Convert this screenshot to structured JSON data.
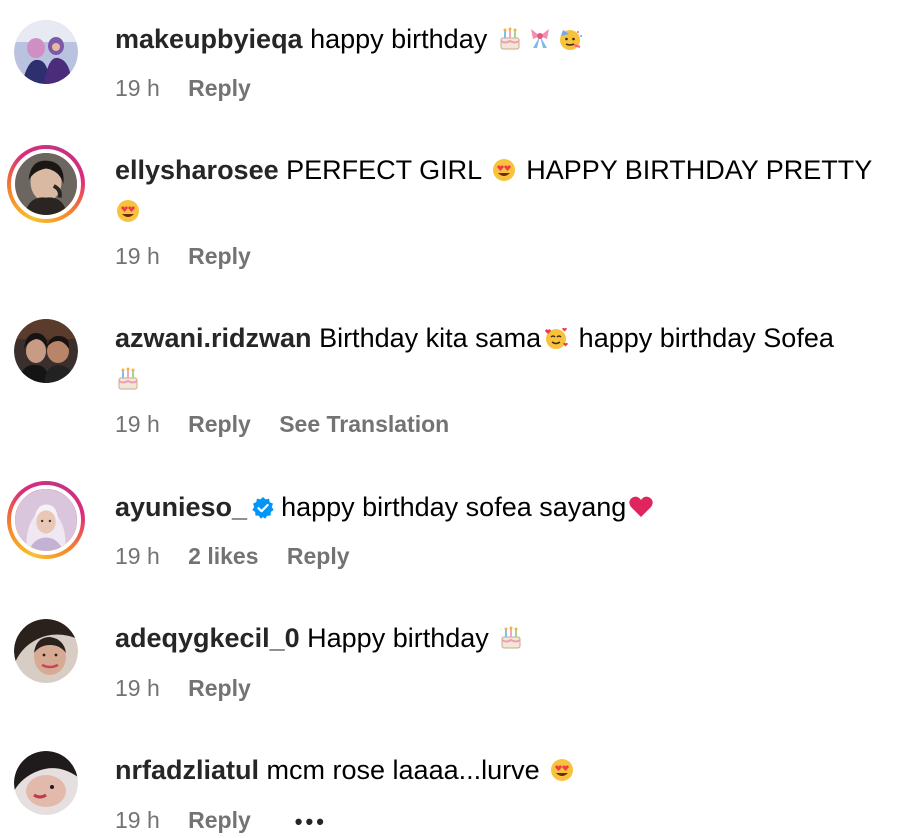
{
  "comments": [
    {
      "username": "makeupbyieqa",
      "text": "happy birthday",
      "emojis": [
        "cake-emoji",
        "ribbon-gift-emoji",
        "party-face-emoji"
      ],
      "time": "19 h",
      "reply": "Reply"
    },
    {
      "username": "ellysharosee",
      "text_a": "PERFECT GIRL",
      "text_b": "HAPPY BIRTHDAY PRETTY",
      "emojis": [
        "heart-eyes-emoji",
        "heart-eyes-emoji"
      ],
      "time": "19 h",
      "reply": "Reply"
    },
    {
      "username": "azwani.ridzwan",
      "text_a": "Birthday kita sama",
      "text_b": "happy birthday Sofea",
      "emojis": [
        "smiling-hearts-emoji",
        "cake-emoji"
      ],
      "time": "19 h",
      "reply": "Reply",
      "translation": "See Translation"
    },
    {
      "username": "ayunieso_",
      "verified_icon": "verified-badge-icon",
      "text": "happy birthday sofea sayang",
      "emojis": [
        "red-heart-emoji"
      ],
      "time": "19 h",
      "likes": "2 likes",
      "reply": "Reply"
    },
    {
      "username": "adeqygkecil_0",
      "text": "Happy birthday",
      "emojis": [
        "cake-emoji"
      ],
      "time": "19 h",
      "reply": "Reply"
    },
    {
      "username": "nrfadzliatul",
      "text": "mcm rose laaaa...lurve",
      "emojis": [
        "heart-eyes-emoji"
      ],
      "time": "19 h",
      "reply": "Reply",
      "more": "•••"
    }
  ],
  "colors": {
    "secondary_text": "#737373",
    "username": "#262626",
    "verified": "#0095f6",
    "story_ring": [
      "#f9c02e",
      "#dd2a7b",
      "#c13584"
    ]
  }
}
